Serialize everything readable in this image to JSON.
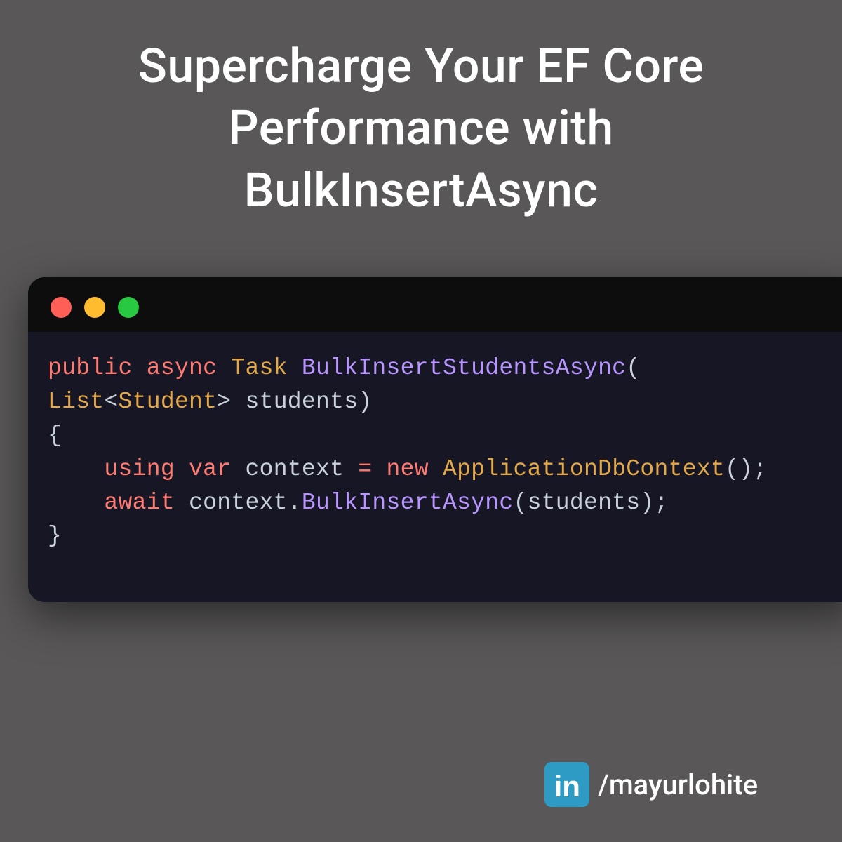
{
  "title": "Supercharge Your EF Core Performance with BulkInsertAsync",
  "code": {
    "tokens": [
      {
        "t": "public",
        "c": "tok-kw"
      },
      {
        "t": " ",
        "c": ""
      },
      {
        "t": "async",
        "c": "tok-kw"
      },
      {
        "t": " ",
        "c": ""
      },
      {
        "t": "Task",
        "c": "tok-type"
      },
      {
        "t": " ",
        "c": ""
      },
      {
        "t": "BulkInsertStudentsAsync",
        "c": "tok-fn"
      },
      {
        "t": "(",
        "c": "tok-punc"
      },
      {
        "t": "\n",
        "c": ""
      },
      {
        "t": "List",
        "c": "tok-type"
      },
      {
        "t": "<",
        "c": "tok-punc"
      },
      {
        "t": "Student",
        "c": "tok-type"
      },
      {
        "t": ">",
        "c": "tok-punc"
      },
      {
        "t": " ",
        "c": ""
      },
      {
        "t": "students",
        "c": "tok-var"
      },
      {
        "t": ")",
        "c": "tok-punc"
      },
      {
        "t": "\n",
        "c": ""
      },
      {
        "t": "{",
        "c": "tok-punc"
      },
      {
        "t": "\n",
        "c": ""
      },
      {
        "t": "    ",
        "c": ""
      },
      {
        "t": "using",
        "c": "tok-kw"
      },
      {
        "t": " ",
        "c": ""
      },
      {
        "t": "var",
        "c": "tok-kw"
      },
      {
        "t": " ",
        "c": ""
      },
      {
        "t": "context",
        "c": "tok-var"
      },
      {
        "t": " ",
        "c": ""
      },
      {
        "t": "=",
        "c": "tok-op"
      },
      {
        "t": " ",
        "c": ""
      },
      {
        "t": "new",
        "c": "tok-kw"
      },
      {
        "t": " ",
        "c": ""
      },
      {
        "t": "ApplicationDbContext",
        "c": "tok-type"
      },
      {
        "t": "();",
        "c": "tok-punc"
      },
      {
        "t": "\n",
        "c": ""
      },
      {
        "t": "    ",
        "c": ""
      },
      {
        "t": "await",
        "c": "tok-kw"
      },
      {
        "t": " ",
        "c": ""
      },
      {
        "t": "context",
        "c": "tok-var"
      },
      {
        "t": ".",
        "c": "tok-punc"
      },
      {
        "t": "BulkInsertAsync",
        "c": "tok-fn"
      },
      {
        "t": "(",
        "c": "tok-punc"
      },
      {
        "t": "students",
        "c": "tok-var"
      },
      {
        "t": ");",
        "c": "tok-punc"
      },
      {
        "t": "\n",
        "c": ""
      },
      {
        "t": "}",
        "c": "tok-punc"
      }
    ]
  },
  "footer": {
    "icon_glyph": "in",
    "handle": "/mayurlohite"
  },
  "window": {
    "dots": [
      "red",
      "yellow",
      "green"
    ]
  }
}
